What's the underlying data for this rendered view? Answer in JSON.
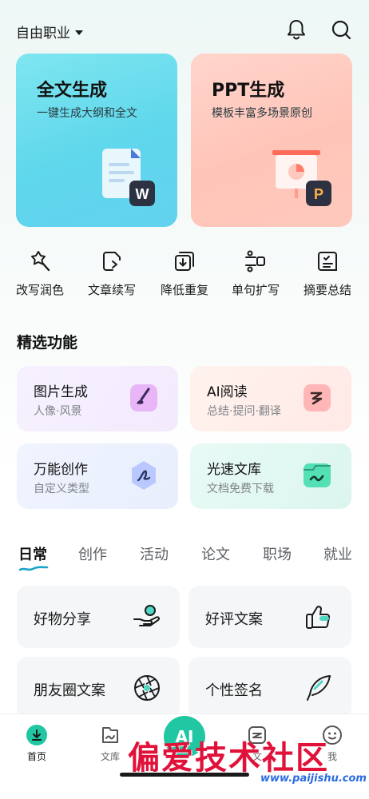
{
  "header": {
    "profession": "自由职业",
    "bell_icon": "bell-icon",
    "search_icon": "search-icon"
  },
  "big_cards": [
    {
      "title": "全文生成",
      "subtitle": "一键生成大纲和全文",
      "badge": "W"
    },
    {
      "title": "PPT生成",
      "subtitle": "模板丰富多场景原创",
      "badge": "P"
    }
  ],
  "tools": [
    {
      "label": "改写润色",
      "icon": "magic-wand-icon"
    },
    {
      "label": "文章续写",
      "icon": "continue-write-icon"
    },
    {
      "label": "降低重复",
      "icon": "dedupe-icon"
    },
    {
      "label": "单句扩写",
      "icon": "expand-icon"
    },
    {
      "label": "摘要总结",
      "icon": "summary-icon"
    }
  ],
  "featured": {
    "title": "精选功能",
    "items": [
      {
        "title": "图片生成",
        "subtitle": "人像·风景",
        "icon": "brush-icon"
      },
      {
        "title": "AI阅读",
        "subtitle": "总结·提问·翻译",
        "icon": "reading-icon"
      },
      {
        "title": "万能创作",
        "subtitle": "自定义类型",
        "icon": "create-icon"
      },
      {
        "title": "光速文库",
        "subtitle": "文档免费下载",
        "icon": "library-icon"
      }
    ]
  },
  "tabs": [
    "日常",
    "创作",
    "活动",
    "论文",
    "职场",
    "就业"
  ],
  "templates": [
    {
      "label": "好物分享",
      "icon": "gift-hand-icon"
    },
    {
      "label": "好评文案",
      "icon": "thumbs-up-icon"
    },
    {
      "label": "朋友圈文案",
      "icon": "aperture-icon"
    },
    {
      "label": "个性签名",
      "icon": "feather-icon"
    }
  ],
  "bottom_nav": [
    {
      "label": "首页",
      "icon": "home-icon"
    },
    {
      "label": "文库",
      "icon": "library-nav-icon"
    },
    {
      "label": "AI",
      "icon": "ai-icon"
    },
    {
      "label": "文",
      "icon": "doc-nav-icon"
    },
    {
      "label": "我",
      "icon": "profile-icon"
    }
  ],
  "watermark": {
    "text": "偏爱技术社区",
    "url": "www.paijishu.com"
  },
  "colors": {
    "accent": "#20c7a2",
    "text": "#1a1a1a",
    "muted": "#808488"
  }
}
